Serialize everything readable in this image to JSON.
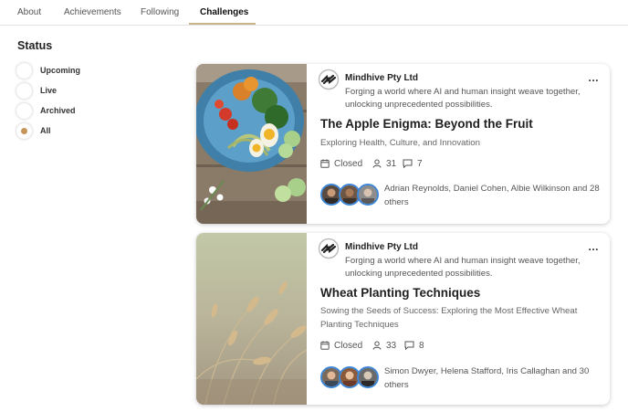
{
  "tabs": [
    {
      "label": "About"
    },
    {
      "label": "Achievements"
    },
    {
      "label": "Following"
    },
    {
      "label": "Challenges",
      "active": true
    }
  ],
  "sidebar": {
    "title": "Status",
    "options": [
      {
        "label": "Upcoming",
        "checked": false
      },
      {
        "label": "Live",
        "checked": false
      },
      {
        "label": "Archived",
        "checked": false
      },
      {
        "label": "All",
        "checked": true
      }
    ]
  },
  "colors": {
    "accent": "#c7955a",
    "avatar_ring": "#3e86d6",
    "tab_underline": "#c9b48c"
  },
  "cards": [
    {
      "org": "Mindhive Pty Ltd",
      "tagline": "Forging a world where AI and human insight weave together, unlocking unprecedented possibilities.",
      "title": "The Apple Enigma: Beyond the Fruit",
      "subtitle": "Exploring Health, Culture, and Innovation",
      "status": "Closed",
      "participants": "31",
      "comments": "7",
      "people": "Adrian Reynolds, Daniel Cohen, Albie Wilkinson and 28 others",
      "image": "salad-bowl-photo",
      "more": "..."
    },
    {
      "org": "Mindhive Pty Ltd",
      "tagline": "Forging a world where AI and human insight weave together, unlocking unprecedented possibilities.",
      "title": "Wheat Planting Techniques",
      "subtitle": "Sowing the Seeds of Success: Exploring the Most Effective Wheat Planting Techniques",
      "status": "Closed",
      "participants": "33",
      "comments": "8",
      "people": "Simon Dwyer, Helena Stafford, Iris Callaghan and 30 others",
      "image": "wheat-field-photo",
      "more": "..."
    }
  ]
}
